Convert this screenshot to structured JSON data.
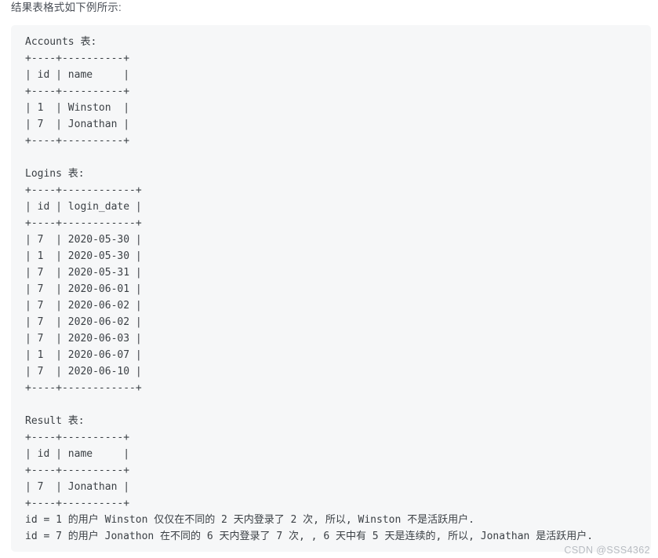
{
  "page": {
    "background_color": "#ffffff"
  },
  "caption": {
    "text": "结果表格式如下例所示:"
  },
  "code_block": {
    "background_color": "#f6f7f8",
    "text_color": "#3b4045",
    "lines": [
      "Accounts 表:",
      "+----+----------+",
      "| id | name     |",
      "+----+----------+",
      "| 1  | Winston  |",
      "| 7  | Jonathan |",
      "+----+----------+",
      "",
      "Logins 表:",
      "+----+------------+",
      "| id | login_date |",
      "+----+------------+",
      "| 7  | 2020-05-30 |",
      "| 1  | 2020-05-30 |",
      "| 7  | 2020-05-31 |",
      "| 7  | 2020-06-01 |",
      "| 7  | 2020-06-02 |",
      "| 7  | 2020-06-02 |",
      "| 7  | 2020-06-03 |",
      "| 1  | 2020-06-07 |",
      "| 7  | 2020-06-10 |",
      "+----+------------+",
      "",
      "Result 表:",
      "+----+----------+",
      "| id | name     |",
      "+----+----------+",
      "| 7  | Jonathan |",
      "+----+----------+",
      "id = 1 的用户 Winston 仅仅在不同的 2 天内登录了 2 次, 所以, Winston 不是活跃用户.",
      "id = 7 的用户 Jonathon 在不同的 6 天内登录了 7 次, , 6 天中有 5 天是连续的, 所以, Jonathan 是活跃用户."
    ],
    "tables": {
      "accounts": {
        "name": "Accounts 表:",
        "columns": [
          "id",
          "name"
        ],
        "rows": [
          [
            "1",
            "Winston"
          ],
          [
            "7",
            "Jonathan"
          ]
        ]
      },
      "logins": {
        "name": "Logins 表:",
        "columns": [
          "id",
          "login_date"
        ],
        "rows": [
          [
            "7",
            "2020-05-30"
          ],
          [
            "1",
            "2020-05-30"
          ],
          [
            "7",
            "2020-05-31"
          ],
          [
            "7",
            "2020-06-01"
          ],
          [
            "7",
            "2020-06-02"
          ],
          [
            "7",
            "2020-06-02"
          ],
          [
            "7",
            "2020-06-03"
          ],
          [
            "1",
            "2020-06-07"
          ],
          [
            "7",
            "2020-06-10"
          ]
        ]
      },
      "result": {
        "name": "Result 表:",
        "columns": [
          "id",
          "name"
        ],
        "rows": [
          [
            "7",
            "Jonathan"
          ]
        ]
      }
    },
    "explanations": [
      "id = 1 的用户 Winston 仅仅在不同的 2 天内登录了 2 次, 所以, Winston 不是活跃用户.",
      "id = 7 的用户 Jonathon 在不同的 6 天内登录了 7 次, , 6 天中有 5 天是连续的, 所以, Jonathan 是活跃用户."
    ]
  },
  "watermark": {
    "text": "CSDN @SSS4362",
    "color": "#b8bcc2"
  }
}
